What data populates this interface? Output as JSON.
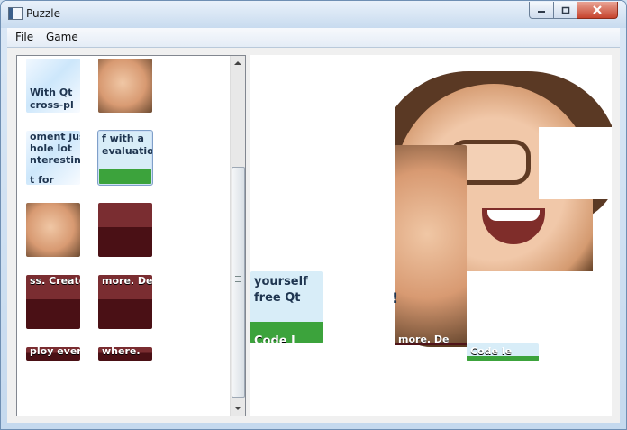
{
  "window": {
    "title": "Puzzle"
  },
  "menubar": {
    "items": [
      "File",
      "Game"
    ]
  },
  "pieces": {
    "list": [
      {
        "name": "piece-1",
        "text": "With Qt\ncross-pl"
      },
      {
        "name": "piece-2",
        "text": ""
      },
      {
        "name": "piece-3",
        "text": "oment just\nhole lot\nnteresting.\nt for"
      },
      {
        "name": "piece-4",
        "text": "f with a\nevaluation!"
      },
      {
        "name": "piece-5",
        "text": ""
      },
      {
        "name": "piece-6",
        "text": ""
      },
      {
        "name": "piece-7",
        "text": "ss. Create"
      },
      {
        "name": "piece-8",
        "text": "more. De"
      },
      {
        "name": "piece-9",
        "text": "ploy every"
      },
      {
        "name": "piece-10",
        "text": "where."
      }
    ]
  },
  "board": {
    "visible_text": [
      "yourself",
      "free Qt",
      "Code l",
      "more. De",
      "Code le",
      "!"
    ]
  }
}
